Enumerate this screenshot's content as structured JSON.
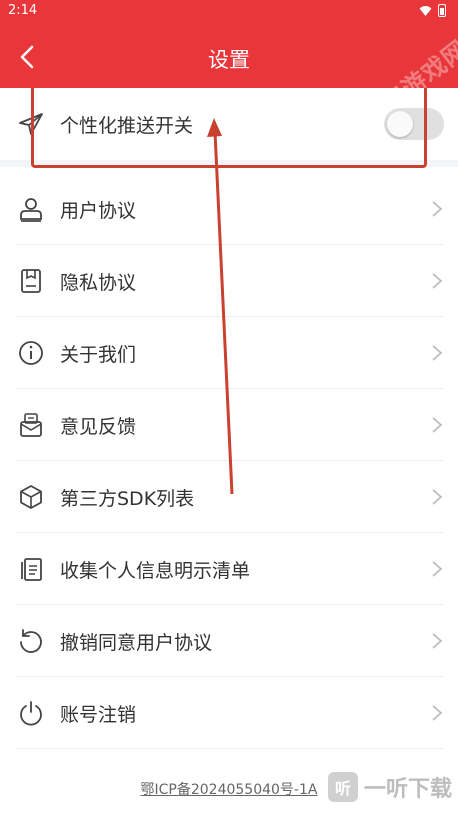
{
  "status_bar": {
    "time": "2:14"
  },
  "app_bar": {
    "title": "设置",
    "watermark": "途知游戏网"
  },
  "push_toggle": {
    "label": "个性化推送开关",
    "enabled": false
  },
  "menu": [
    {
      "label": "用户协议",
      "icon": "user-agreement-icon"
    },
    {
      "label": "隐私协议",
      "icon": "privacy-policy-icon"
    },
    {
      "label": "关于我们",
      "icon": "info-icon"
    },
    {
      "label": "意见反馈",
      "icon": "feedback-icon"
    },
    {
      "label": "第三方SDK列表",
      "icon": "sdk-box-icon"
    },
    {
      "label": "收集个人信息明示清单",
      "icon": "document-list-icon"
    },
    {
      "label": "撤销同意用户协议",
      "icon": "revoke-icon"
    },
    {
      "label": "账号注销",
      "icon": "power-icon"
    }
  ],
  "footer": {
    "icp": "鄂ICP备2024055040号-1A",
    "brand": "一听下载",
    "brand_mark": "听"
  },
  "colors": {
    "accent": "#e8363a",
    "annotation": "#c9412f",
    "text": "#333333",
    "icon": "#444444"
  }
}
